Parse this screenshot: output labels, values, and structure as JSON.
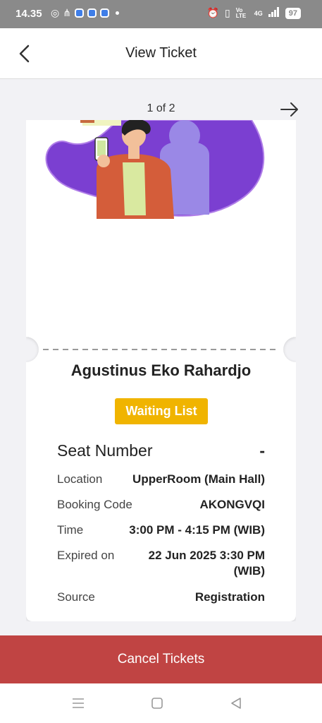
{
  "status_bar": {
    "time": "14.35",
    "battery": "97",
    "network": "4G",
    "volte": "Vo LTE"
  },
  "header": {
    "title": "View Ticket"
  },
  "pager": {
    "text": "1 of 2"
  },
  "ticket": {
    "name": "Agustinus Eko Rahardjo",
    "status": "Waiting List",
    "seat_label": "Seat Number",
    "seat_value": "-",
    "details": [
      {
        "label": "Location",
        "value": "UpperRoom (Main Hall)"
      },
      {
        "label": "Booking Code",
        "value": "AKONGVQI"
      },
      {
        "label": "Time",
        "value": "3:00 PM - 4:15 PM (WIB)"
      },
      {
        "label": "Expired on",
        "value": "22 Jun 2025 3:30 PM (WIB)"
      },
      {
        "label": "Source",
        "value": "Registration"
      }
    ]
  },
  "actions": {
    "cancel_label": "Cancel Tickets"
  },
  "colors": {
    "status_badge": "#f0b400",
    "cancel_button": "#c04443",
    "illustration_blob": "#7b3fd1"
  }
}
